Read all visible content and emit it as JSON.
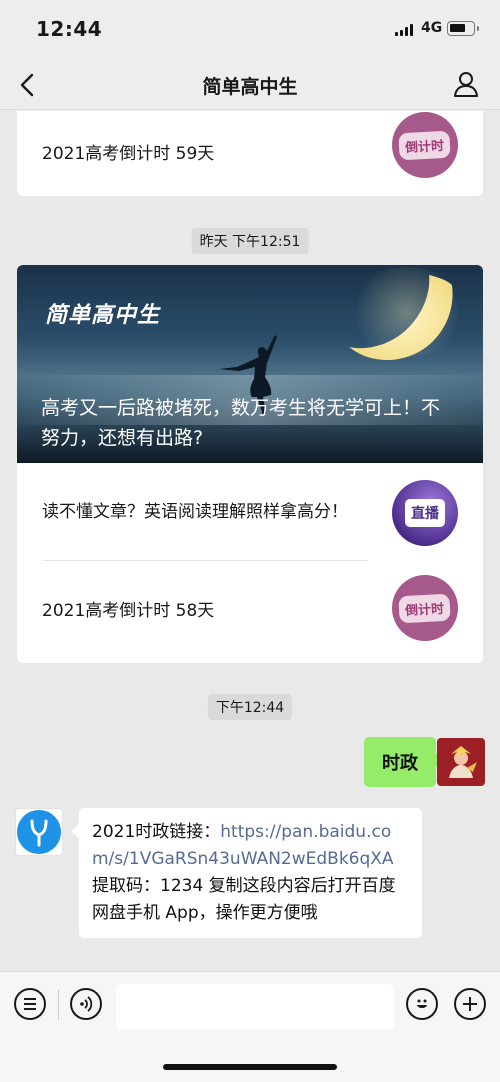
{
  "status_bar": {
    "time": "12:44",
    "network": "4G"
  },
  "nav": {
    "title": "简单高中生"
  },
  "top_card": {
    "item": {
      "text": "2021高考倒计时 59天",
      "thumb_label": "倒计时"
    }
  },
  "timestamps": {
    "first": "昨天 下午12:51",
    "second": "下午12:44"
  },
  "article_card": {
    "brand": "简单高中生",
    "hero_title": "高考又一后路被堵死，数万考生将无学可上！不努力，还想有出路?",
    "items": [
      {
        "text": "读不懂文章？英语阅读理解照样拿高分！",
        "thumb_label": "直播"
      },
      {
        "text": "2021高考倒计时 58天",
        "thumb_label": "倒计时"
      }
    ]
  },
  "messages": {
    "outgoing": {
      "text": "时政"
    },
    "incoming": {
      "prefix": "2021时政链接：",
      "link": "https://pan.baidu.com/s/1VGaRSn43uWAN2wEdBk6qXA",
      "suffix": " 提取码：1234 复制这段内容后打开百度网盘手机 App，操作更方便哦"
    }
  },
  "colors": {
    "outgoing_bubble": "#95ec69",
    "link": "#576b95",
    "chat_bg": "#e9e9e9"
  },
  "icons": {
    "back": "chevron-left-icon",
    "profile": "person-icon",
    "menu": "menu-list-icon",
    "voice": "voice-icon",
    "emoji": "emoji-icon",
    "add": "plus-icon"
  }
}
